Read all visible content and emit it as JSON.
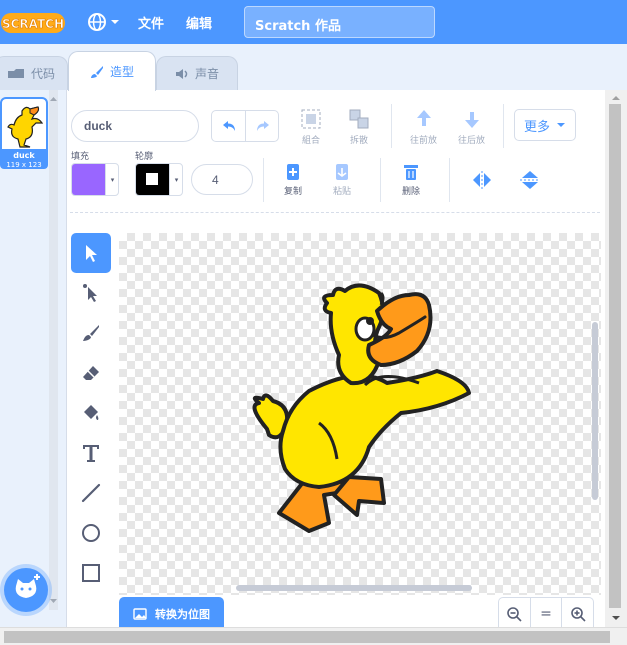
{
  "menubar": {
    "logo_text": "SCRATCH",
    "file_label": "文件",
    "edit_label": "编辑",
    "project_title": "Scratch 作品"
  },
  "tabs": [
    {
      "label": "代码",
      "icon": "code-icon"
    },
    {
      "label": "造型",
      "icon": "brush-icon",
      "active": true
    },
    {
      "label": "声音",
      "icon": "speaker-icon"
    }
  ],
  "sprite": {
    "name": "duck",
    "size": "119 x 123"
  },
  "toolbar": {
    "costume_name": "duck",
    "group_label": "組合",
    "ungroup_label": "拆散",
    "forward_label": "往前放",
    "backward_label": "往后放",
    "more_label": "更多",
    "fill_label": "填充",
    "outline_label": "轮廓",
    "outline_width": "4",
    "copy_label": "复制",
    "paste_label": "粘贴",
    "delete_label": "删除"
  },
  "colors": {
    "fill": "#9966ff",
    "outline": "#000000",
    "accent": "#4c97ff"
  },
  "tools": [
    "select",
    "reshape",
    "brush",
    "eraser",
    "fill",
    "text",
    "line",
    "circle",
    "rectangle"
  ],
  "canvas": {
    "convert_label": "转换为位图"
  },
  "zoom": {
    "zoom_out": "zoom-out-icon",
    "reset_label": "=",
    "zoom_in": "zoom-in-icon"
  }
}
